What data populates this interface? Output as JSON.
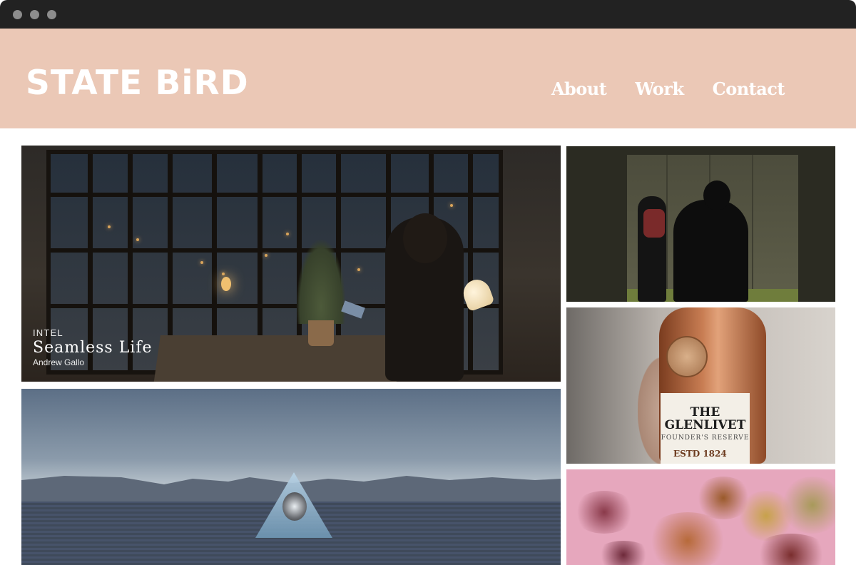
{
  "brand": {
    "logo": "STATE BiRD",
    "header_color": "#ebc8b6"
  },
  "nav": {
    "items": [
      {
        "label": "About"
      },
      {
        "label": "Work"
      },
      {
        "label": "Contact"
      }
    ]
  },
  "projects": [
    {
      "client": "INTEL",
      "title": "Seamless Life",
      "author": "Andrew Gallo"
    },
    {
      "image_label": {
        "line1": "THE",
        "line2": "GLENLIVET",
        "sub": "FOUNDER'S RESERVE",
        "estd": "ESTD 1824"
      }
    }
  ]
}
